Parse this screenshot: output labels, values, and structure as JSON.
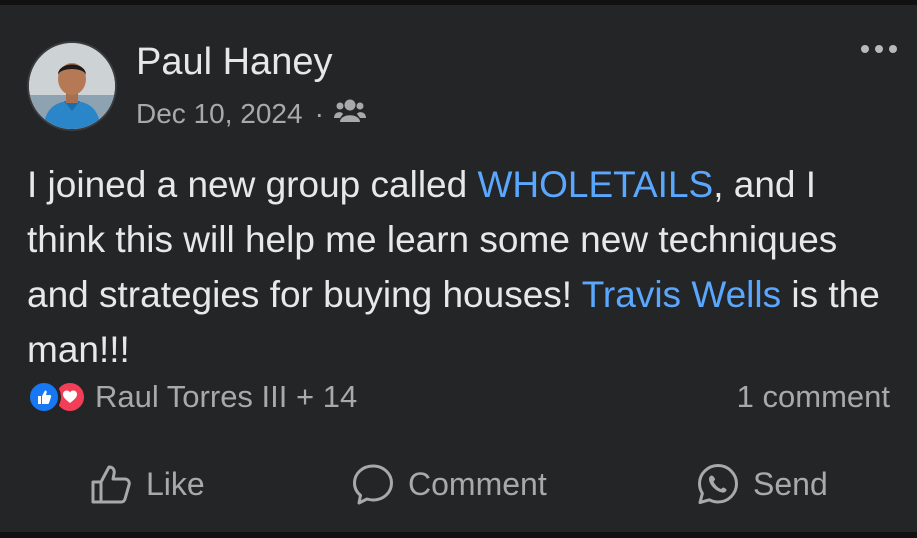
{
  "post": {
    "author": "Paul Haney",
    "date": "Dec 10, 2024",
    "separator": "·",
    "audience_icon": "group-icon",
    "more_icon": "more-options-icon",
    "body": {
      "text_1": "I joined a new group called ",
      "link_1": "WHOLETAILS",
      "text_2": ", and I think this will help me learn some new techniques and strategies for buying houses! ",
      "link_2": "Travis Wells",
      "text_3": " is the man!!!"
    },
    "reactions": {
      "icons": [
        "like-reaction-icon",
        "love-reaction-icon"
      ],
      "names": "Raul Torres III + 14"
    },
    "comments_count": "1 comment"
  },
  "actions": {
    "like": "Like",
    "comment": "Comment",
    "send": "Send"
  },
  "colors": {
    "background": "#242526",
    "text": "#e8e8e8",
    "secondary_text": "#a8a9ab",
    "link": "#5aa7ff",
    "like_blue": "#1877f2",
    "love_red": "#f33e58"
  }
}
